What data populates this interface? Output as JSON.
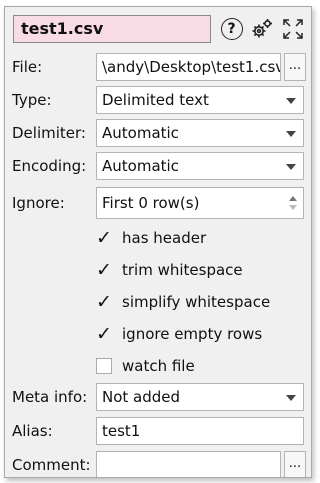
{
  "header": {
    "title": "test1.csv",
    "help_icon": "question-mark-circle",
    "settings_icon": "gears-icon",
    "expand_icon": "expand-arrows-icon",
    "title_bg": "#f9dbe6"
  },
  "file": {
    "label": "File:",
    "value": "\\andy\\Desktop\\test1.csv",
    "browse_label": "..."
  },
  "type": {
    "label": "Type:",
    "value": "Delimited text"
  },
  "delimiter": {
    "label": "Delimiter:",
    "value": "Automatic"
  },
  "encoding": {
    "label": "Encoding:",
    "value": "Automatic"
  },
  "ignore": {
    "label": "Ignore:",
    "value": "First 0 row(s)"
  },
  "checkboxes": [
    {
      "label": "has header",
      "checked": true
    },
    {
      "label": "trim whitespace",
      "checked": true
    },
    {
      "label": "simplify whitespace",
      "checked": true
    },
    {
      "label": "ignore empty rows",
      "checked": true
    },
    {
      "label": "watch file",
      "checked": false
    }
  ],
  "meta_info": {
    "label": "Meta info:",
    "value": "Not added"
  },
  "alias": {
    "label": "Alias:",
    "value": "test1"
  },
  "comment": {
    "label": "Comment:",
    "value": "",
    "browse_label": "..."
  }
}
